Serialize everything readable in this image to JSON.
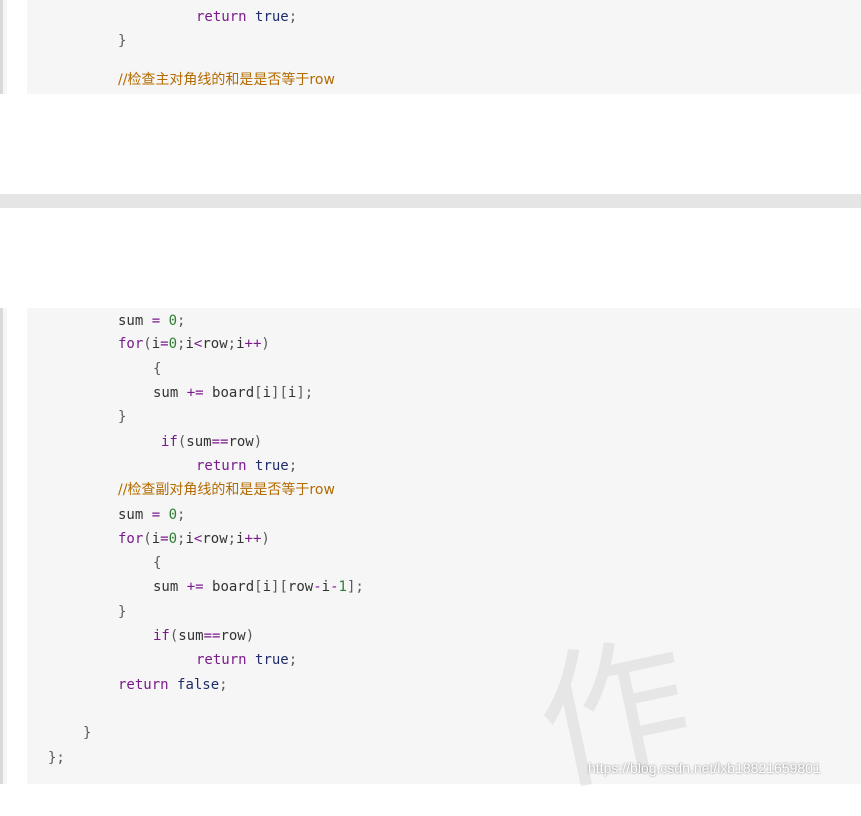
{
  "code_top": {
    "lines": [
      {
        "id": "t1",
        "parts": [
          {
            "t": "return",
            "c": "kw"
          },
          {
            "t": " ",
            "c": ""
          },
          {
            "t": "true",
            "c": "val"
          },
          {
            "t": ";",
            "c": "punc"
          }
        ]
      },
      {
        "id": "t2",
        "parts": [
          {
            "t": "}",
            "c": "punc"
          }
        ]
      },
      {
        "id": "t3",
        "parts": [
          {
            "t": "//检查主对角线的和是是否等于row",
            "c": "comment"
          }
        ]
      }
    ]
  },
  "code_bottom": {
    "lines": [
      {
        "id": "b1",
        "parts": [
          {
            "t": "sum",
            "c": ""
          },
          {
            "t": " = ",
            "c": "op"
          },
          {
            "t": "0",
            "c": "num"
          },
          {
            "t": ";",
            "c": "punc"
          }
        ]
      },
      {
        "id": "b2",
        "parts": [
          {
            "t": "for",
            "c": "kw"
          },
          {
            "t": "(",
            "c": "punc"
          },
          {
            "t": "i",
            "c": ""
          },
          {
            "t": "=",
            "c": "op"
          },
          {
            "t": "0",
            "c": "num"
          },
          {
            "t": ";",
            "c": "punc"
          },
          {
            "t": "i",
            "c": ""
          },
          {
            "t": "<",
            "c": "op"
          },
          {
            "t": "row",
            "c": ""
          },
          {
            "t": ";",
            "c": "punc"
          },
          {
            "t": "i",
            "c": ""
          },
          {
            "t": "++",
            "c": "op"
          },
          {
            "t": ")",
            "c": "punc"
          }
        ]
      },
      {
        "id": "b3",
        "parts": [
          {
            "t": "{",
            "c": "punc"
          }
        ]
      },
      {
        "id": "b4",
        "parts": [
          {
            "t": "sum",
            "c": ""
          },
          {
            "t": " += ",
            "c": "op"
          },
          {
            "t": "board",
            "c": ""
          },
          {
            "t": "[",
            "c": "punc"
          },
          {
            "t": "i",
            "c": ""
          },
          {
            "t": "][",
            "c": "punc"
          },
          {
            "t": "i",
            "c": ""
          },
          {
            "t": "];",
            "c": "punc"
          }
        ]
      },
      {
        "id": "b5",
        "parts": [
          {
            "t": "}",
            "c": "punc"
          }
        ]
      },
      {
        "id": "b6",
        "parts": [
          {
            "t": "if",
            "c": "kw"
          },
          {
            "t": "(",
            "c": "punc"
          },
          {
            "t": "sum",
            "c": ""
          },
          {
            "t": "==",
            "c": "op"
          },
          {
            "t": "row",
            "c": ""
          },
          {
            "t": ")",
            "c": "punc"
          }
        ]
      },
      {
        "id": "b7",
        "parts": [
          {
            "t": "return",
            "c": "kw"
          },
          {
            "t": " ",
            "c": ""
          },
          {
            "t": "true",
            "c": "val"
          },
          {
            "t": ";",
            "c": "punc"
          }
        ]
      },
      {
        "id": "b8",
        "parts": [
          {
            "t": "//检查副对角线的和是是否等于row",
            "c": "comment"
          }
        ]
      },
      {
        "id": "b9",
        "parts": [
          {
            "t": "sum",
            "c": ""
          },
          {
            "t": " = ",
            "c": "op"
          },
          {
            "t": "0",
            "c": "num"
          },
          {
            "t": ";",
            "c": "punc"
          }
        ]
      },
      {
        "id": "b10",
        "parts": [
          {
            "t": "for",
            "c": "kw"
          },
          {
            "t": "(",
            "c": "punc"
          },
          {
            "t": "i",
            "c": ""
          },
          {
            "t": "=",
            "c": "op"
          },
          {
            "t": "0",
            "c": "num"
          },
          {
            "t": ";",
            "c": "punc"
          },
          {
            "t": "i",
            "c": ""
          },
          {
            "t": "<",
            "c": "op"
          },
          {
            "t": "row",
            "c": ""
          },
          {
            "t": ";",
            "c": "punc"
          },
          {
            "t": "i",
            "c": ""
          },
          {
            "t": "++",
            "c": "op"
          },
          {
            "t": ")",
            "c": "punc"
          }
        ]
      },
      {
        "id": "b11",
        "parts": [
          {
            "t": "{",
            "c": "punc"
          }
        ]
      },
      {
        "id": "b12",
        "parts": [
          {
            "t": "sum",
            "c": ""
          },
          {
            "t": " += ",
            "c": "op"
          },
          {
            "t": "board",
            "c": ""
          },
          {
            "t": "[",
            "c": "punc"
          },
          {
            "t": "i",
            "c": ""
          },
          {
            "t": "][",
            "c": "punc"
          },
          {
            "t": "row",
            "c": ""
          },
          {
            "t": "-",
            "c": "op"
          },
          {
            "t": "i",
            "c": ""
          },
          {
            "t": "-",
            "c": "op"
          },
          {
            "t": "1",
            "c": "num"
          },
          {
            "t": "];",
            "c": "punc"
          }
        ]
      },
      {
        "id": "b13",
        "parts": [
          {
            "t": "}",
            "c": "punc"
          }
        ]
      },
      {
        "id": "b14",
        "parts": [
          {
            "t": "if",
            "c": "kw"
          },
          {
            "t": "(",
            "c": "punc"
          },
          {
            "t": "sum",
            "c": ""
          },
          {
            "t": "==",
            "c": "op"
          },
          {
            "t": "row",
            "c": ""
          },
          {
            "t": ")",
            "c": "punc"
          }
        ]
      },
      {
        "id": "b15",
        "parts": [
          {
            "t": "return",
            "c": "kw"
          },
          {
            "t": " ",
            "c": ""
          },
          {
            "t": "true",
            "c": "val"
          },
          {
            "t": ";",
            "c": "punc"
          }
        ]
      },
      {
        "id": "b16",
        "parts": [
          {
            "t": "return",
            "c": "kw"
          },
          {
            "t": " ",
            "c": ""
          },
          {
            "t": "false",
            "c": "val"
          },
          {
            "t": ";",
            "c": "punc"
          }
        ]
      },
      {
        "id": "b17",
        "parts": [
          {
            "t": "}",
            "c": "punc"
          }
        ]
      },
      {
        "id": "b18",
        "parts": [
          {
            "t": "};",
            "c": "punc"
          }
        ]
      }
    ]
  },
  "watermark": {
    "url": "https://blog.csdn.net/lxb18821659801",
    "big_char": "作"
  }
}
